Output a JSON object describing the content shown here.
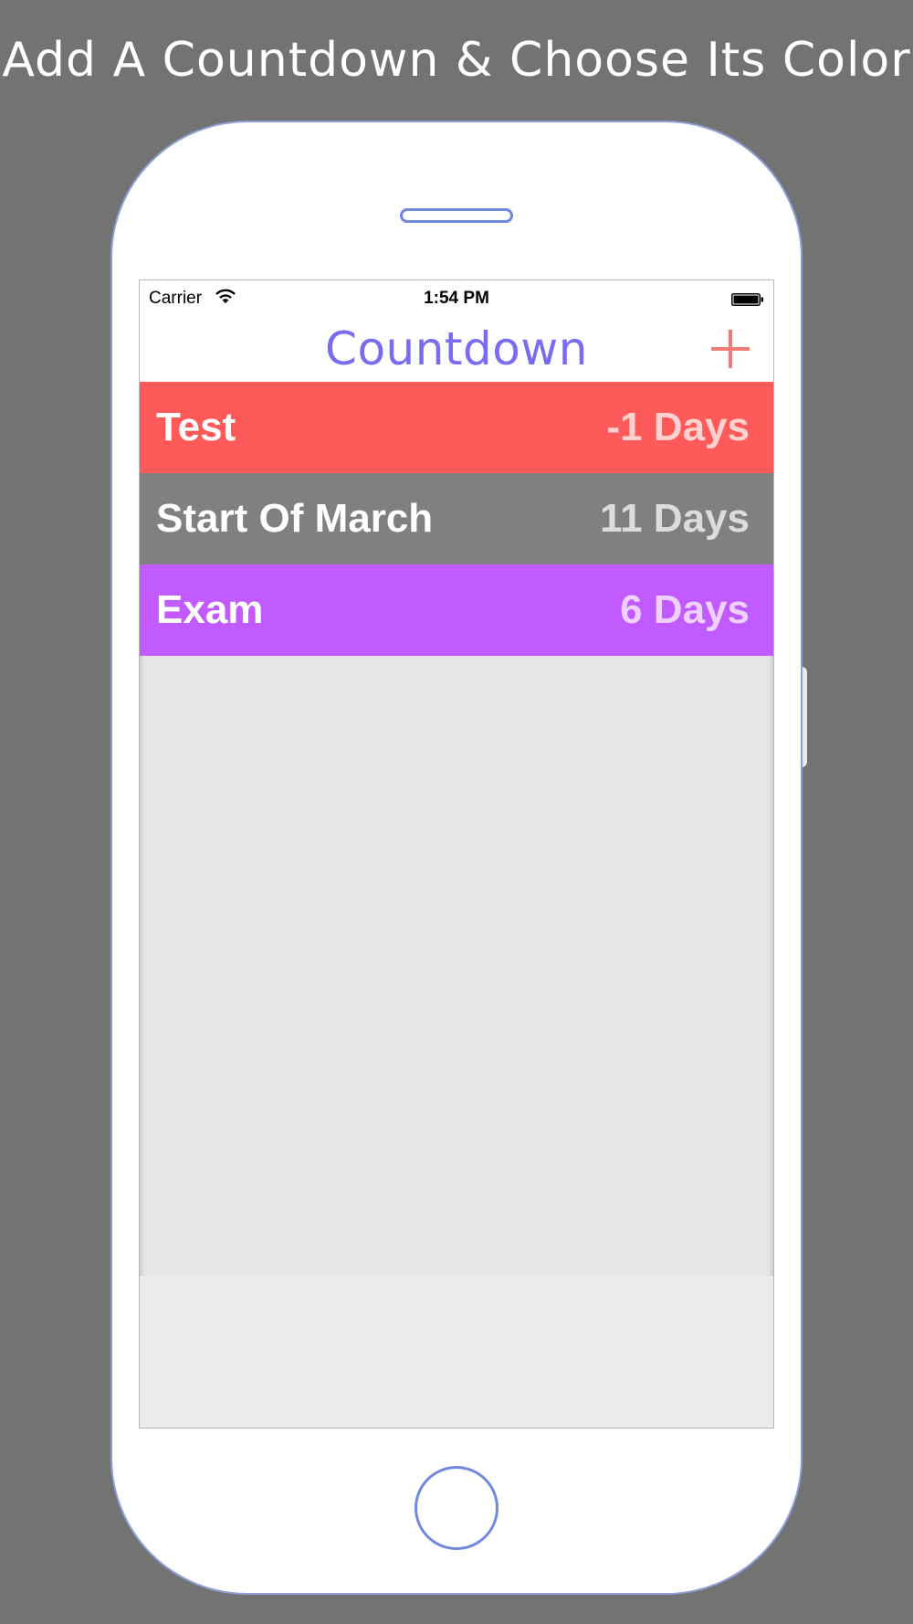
{
  "headline": "Add A Countdown & Choose Its Color",
  "status_bar": {
    "carrier": "Carrier",
    "time": "1:54 PM",
    "wifi_icon": "wifi-icon",
    "battery_icon": "battery-icon"
  },
  "nav": {
    "title": "Countdown",
    "add_icon": "plus-icon",
    "add_color": "#f47a78",
    "title_color": "#7a6cf0"
  },
  "countdowns": [
    {
      "name": "Test",
      "days": "-1 Days",
      "color": "#ff5a5a"
    },
    {
      "name": "Start Of March",
      "days": "11 Days",
      "color": "#808080"
    },
    {
      "name": "Exam",
      "days": "6 Days",
      "color": "#c25bff"
    }
  ]
}
